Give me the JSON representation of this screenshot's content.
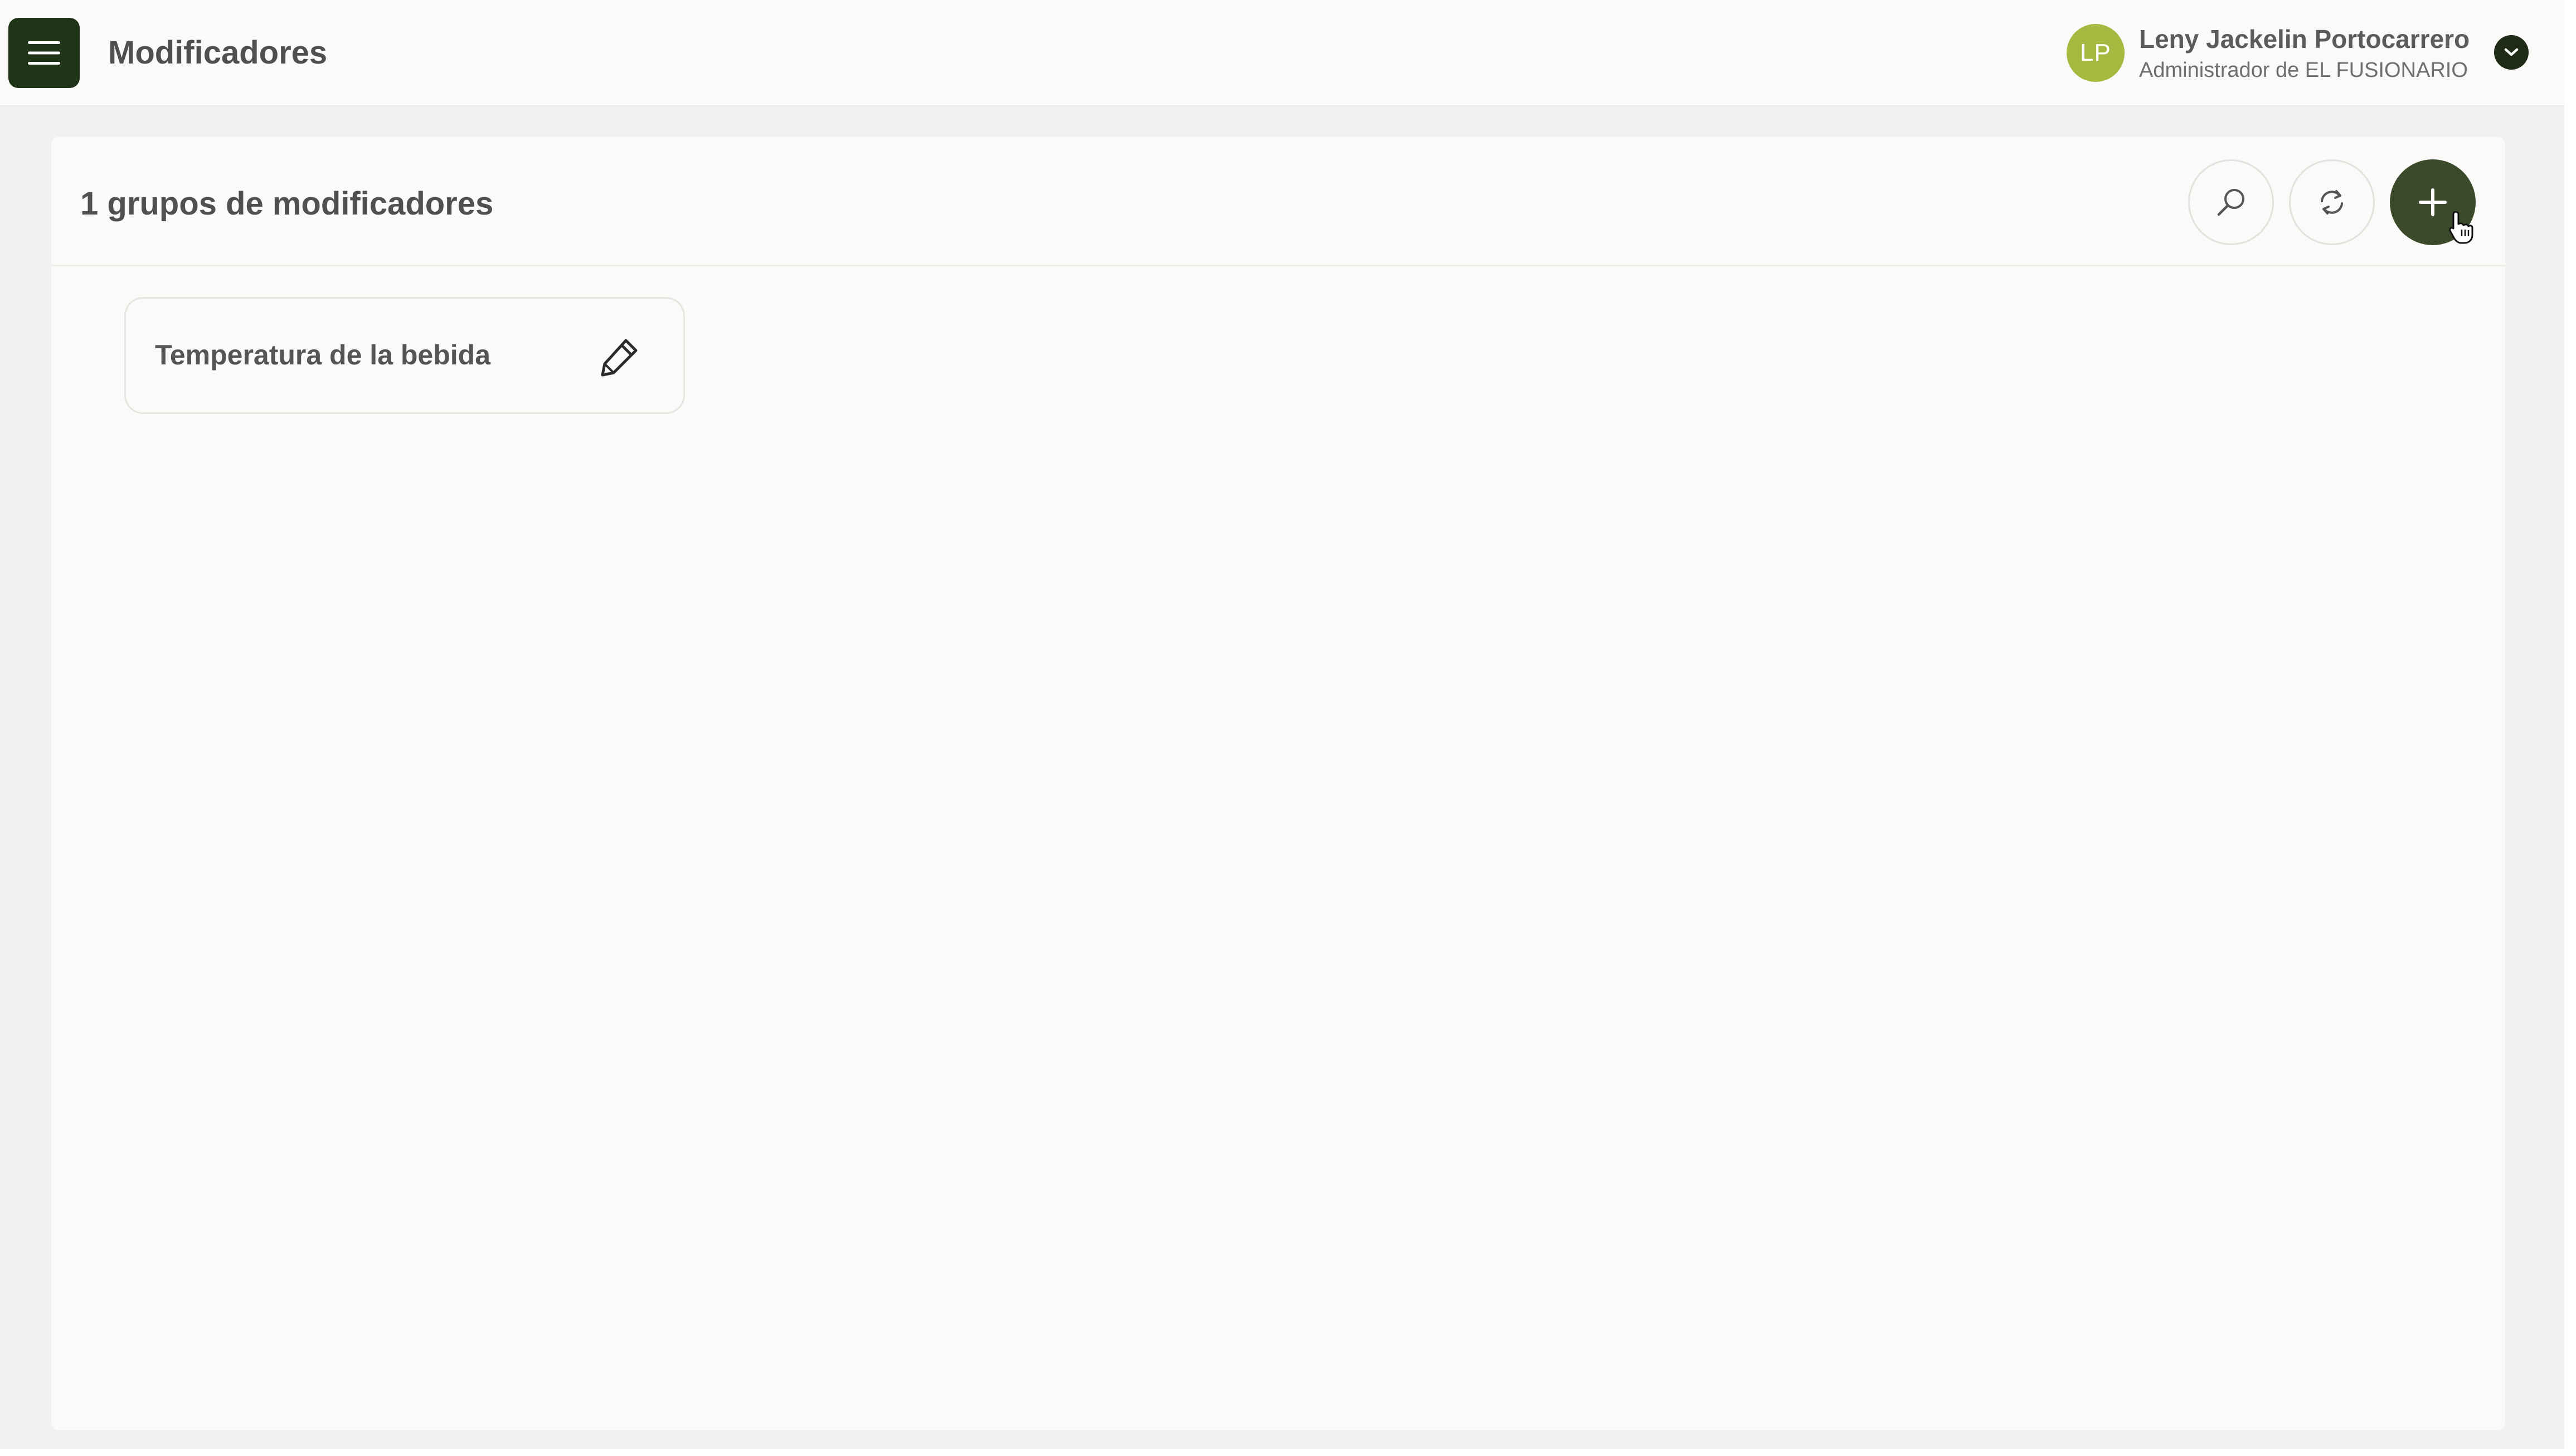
{
  "header": {
    "title": "Modificadores",
    "menu_icon": "hamburger-icon",
    "user": {
      "initials": "LP",
      "name": "Leny Jackelin Portocarrero",
      "role": "Administrador de EL FUSIONARIO",
      "dropdown_icon": "chevron-down-icon"
    }
  },
  "main": {
    "title": "1 grupos de modificadores",
    "actions": {
      "search_icon": "search-icon",
      "refresh_icon": "refresh-icon",
      "add_icon": "plus-icon"
    },
    "groups": [
      {
        "name": "Temperatura de la bebida",
        "edit_icon": "pencil-icon"
      }
    ]
  },
  "colors": {
    "brand_dark": "#1f3317",
    "add_button": "#3a4a2b",
    "avatar": "#a3b93f",
    "background": "#f2f1ef",
    "surface": "#fbfaf8"
  }
}
